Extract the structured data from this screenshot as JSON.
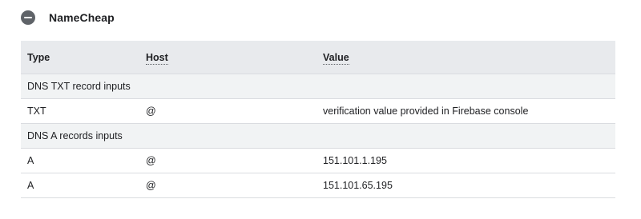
{
  "section": {
    "title": "NameCheap",
    "toggle_icon": "collapse-minus-icon"
  },
  "table": {
    "headers": {
      "type": "Type",
      "host": "Host",
      "value": "Value"
    },
    "groups": [
      {
        "label": "DNS TXT record inputs",
        "rows": [
          {
            "type": "TXT",
            "host": "@",
            "value": "verification value provided in Firebase console"
          }
        ]
      },
      {
        "label": "DNS A records inputs",
        "rows": [
          {
            "type": "A",
            "host": "@",
            "value": "151.101.1.195"
          },
          {
            "type": "A",
            "host": "@",
            "value": "151.101.65.195"
          }
        ]
      }
    ]
  },
  "colors": {
    "header_bg": "#e8eaed",
    "group_row_bg": "#f1f3f4",
    "border": "#dadce0",
    "icon": "#5f6368",
    "text": "#202124"
  }
}
